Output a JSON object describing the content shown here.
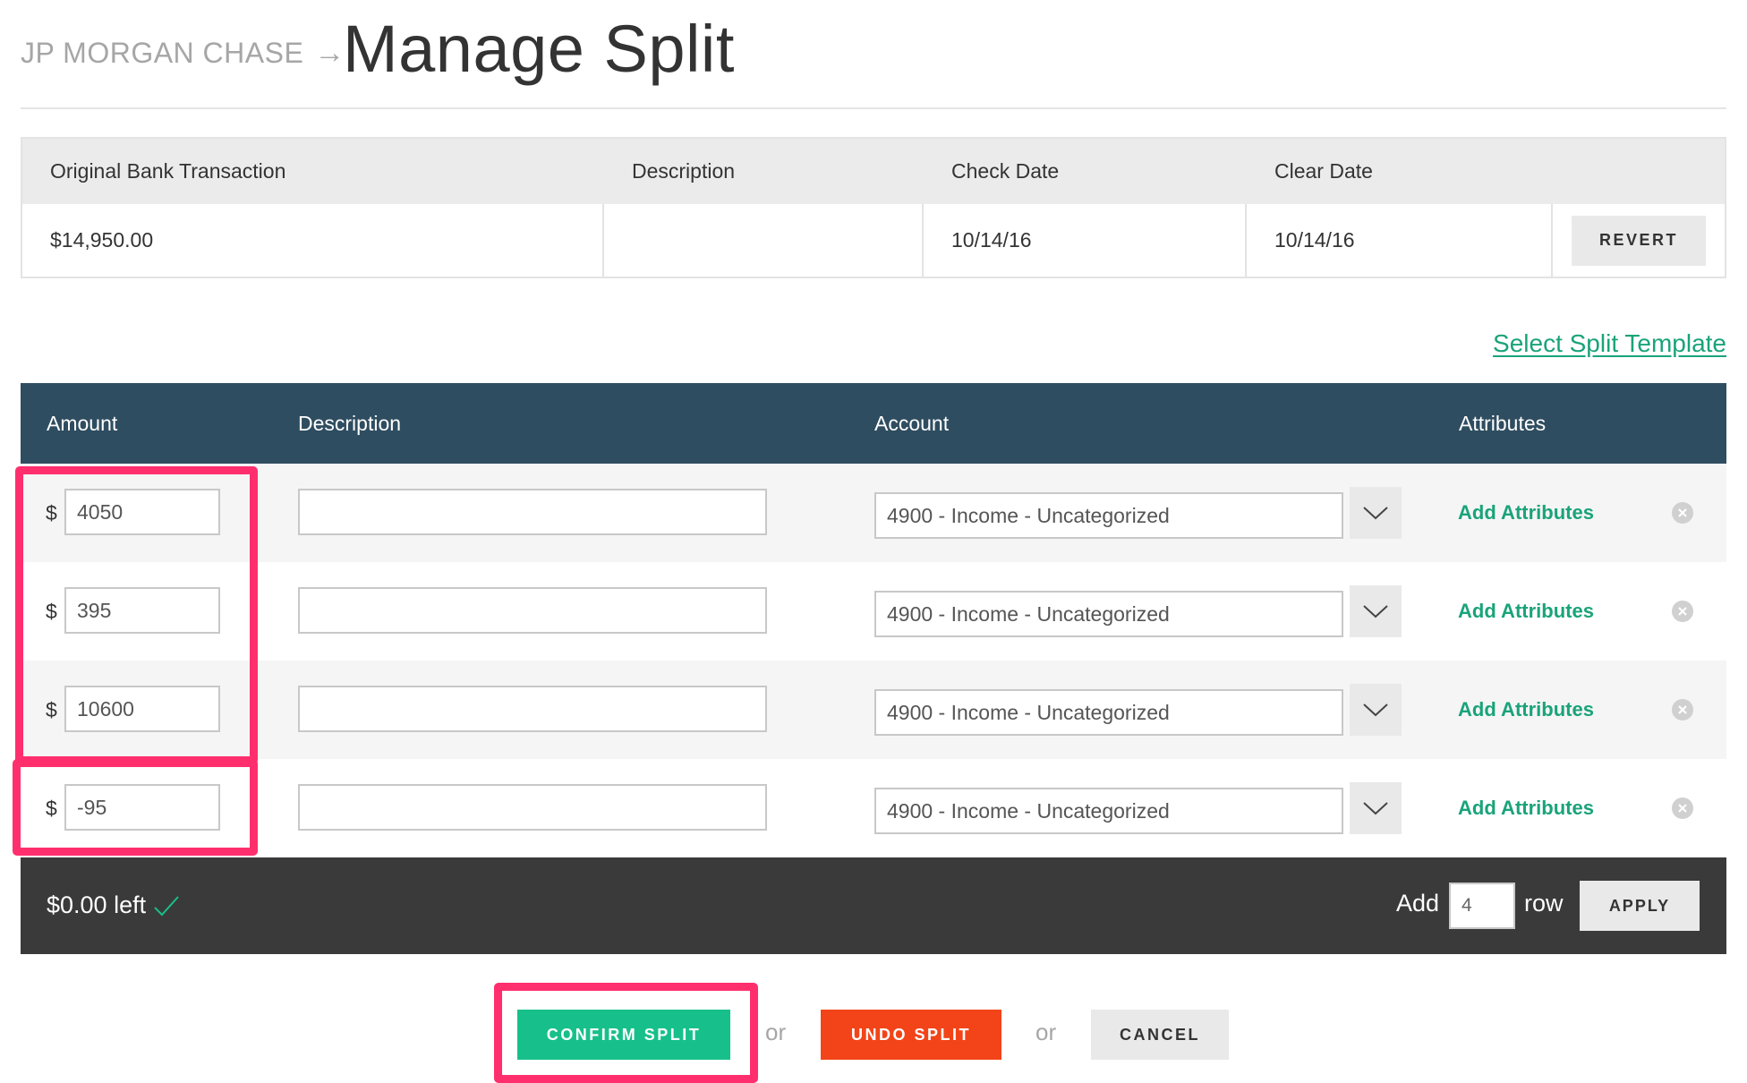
{
  "header": {
    "breadcrumb": "JP MORGAN CHASE",
    "arrow": "→",
    "title": "Manage Split"
  },
  "original": {
    "headers": [
      "Original Bank Transaction",
      "Description",
      "Check Date",
      "Clear Date"
    ],
    "row": {
      "amount": "$14,950.00",
      "description": "",
      "check_date": "10/14/16",
      "clear_date": "10/14/16"
    },
    "revert_label": "REVERT"
  },
  "template_link": "Select Split Template",
  "split": {
    "headers": {
      "amount": "Amount",
      "description": "Description",
      "account": "Account",
      "attributes": "Attributes"
    },
    "currency": "$",
    "rows": [
      {
        "amount": "4050",
        "description": "",
        "account": "4900 - Income - Uncategorized",
        "attr_label": "Add Attributes"
      },
      {
        "amount": "395",
        "description": "",
        "account": "4900 - Income - Uncategorized",
        "attr_label": "Add Attributes"
      },
      {
        "amount": "10600",
        "description": "",
        "account": "4900 - Income - Uncategorized",
        "attr_label": "Add Attributes"
      },
      {
        "amount": "-95",
        "description": "",
        "account": "4900 - Income - Uncategorized",
        "attr_label": "Add Attributes"
      }
    ]
  },
  "footer": {
    "left": "$0.00 left",
    "add_label": "Add",
    "row_count": "4",
    "row_label": "row",
    "apply_label": "APPLY"
  },
  "actions": {
    "confirm_label": "CONFIRM SPLIT",
    "or_text": "or",
    "undo_label": "UNDO SPLIT",
    "cancel_label": "CANCEL"
  },
  "colors": {
    "accent_green": "#17c08a",
    "link_green": "#1aa37a",
    "header_navy": "#2f4d60",
    "footer_dark": "#3a3a3a",
    "undo_orange": "#f24418",
    "highlight_pink": "#ff2f6e"
  },
  "icons": [
    "arrow-right-icon",
    "chevron-down-icon",
    "close-circle-icon",
    "check-icon"
  ]
}
